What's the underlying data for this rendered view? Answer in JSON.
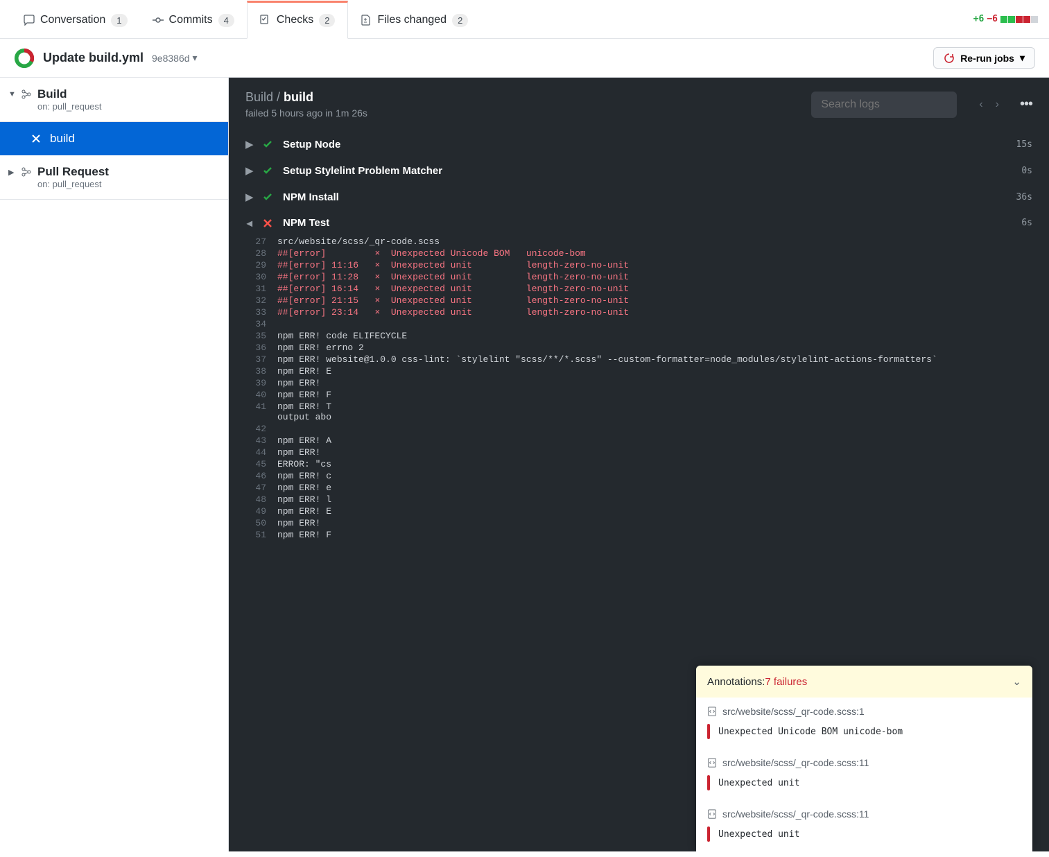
{
  "tabs": {
    "conversation": {
      "label": "Conversation",
      "count": "1"
    },
    "commits": {
      "label": "Commits",
      "count": "4"
    },
    "checks": {
      "label": "Checks",
      "count": "2"
    },
    "files": {
      "label": "Files changed",
      "count": "2"
    }
  },
  "diffstat": {
    "additions": "+6",
    "deletions": "−6"
  },
  "pr": {
    "title": "Update build.yml",
    "sha": "9e8386d",
    "rerun_label": "Re-run jobs"
  },
  "workflows": [
    {
      "name": "Build",
      "trigger": "on: pull_request",
      "jobs": [
        {
          "name": "build",
          "status": "fail",
          "active": true
        }
      ]
    },
    {
      "name": "Pull Request",
      "trigger": "on: pull_request",
      "jobs": []
    }
  ],
  "log": {
    "breadcrumb_parent": "Build",
    "breadcrumb_sep": " / ",
    "breadcrumb_current": "build",
    "status_line": "failed 5 hours ago in 1m 26s",
    "search_placeholder": "Search logs"
  },
  "steps": [
    {
      "name": "Setup Node",
      "status": "pass",
      "time": "15s",
      "expanded": false
    },
    {
      "name": "Setup Stylelint Problem Matcher",
      "status": "pass",
      "time": "0s",
      "expanded": false
    },
    {
      "name": "NPM Install",
      "status": "pass",
      "time": "36s",
      "expanded": false
    },
    {
      "name": "NPM Test",
      "status": "fail",
      "time": "6s",
      "expanded": true
    }
  ],
  "loglines": [
    {
      "n": "27",
      "text": "src/website/scss/_qr-code.scss"
    },
    {
      "n": "28",
      "err": true,
      "prefix": "##[error]",
      "loc": "",
      "x": "×",
      "msg": "Unexpected Unicode BOM",
      "rule": "unicode-bom"
    },
    {
      "n": "29",
      "err": true,
      "prefix": "##[error]",
      "loc": "11:16",
      "x": "×",
      "msg": "Unexpected unit",
      "rule": "length-zero-no-unit"
    },
    {
      "n": "30",
      "err": true,
      "prefix": "##[error]",
      "loc": "11:28",
      "x": "×",
      "msg": "Unexpected unit",
      "rule": "length-zero-no-unit"
    },
    {
      "n": "31",
      "err": true,
      "prefix": "##[error]",
      "loc": "16:14",
      "x": "×",
      "msg": "Unexpected unit",
      "rule": "length-zero-no-unit"
    },
    {
      "n": "32",
      "err": true,
      "prefix": "##[error]",
      "loc": "21:15",
      "x": "×",
      "msg": "Unexpected unit",
      "rule": "length-zero-no-unit"
    },
    {
      "n": "33",
      "err": true,
      "prefix": "##[error]",
      "loc": "23:14",
      "x": "×",
      "msg": "Unexpected unit",
      "rule": "length-zero-no-unit"
    },
    {
      "n": "34",
      "text": ""
    },
    {
      "n": "35",
      "text": "npm ERR! code ELIFECYCLE"
    },
    {
      "n": "36",
      "text": "npm ERR! errno 2"
    },
    {
      "n": "37",
      "text": "npm ERR! website@1.0.0 css-lint: `stylelint \"scss/**/*.scss\" --custom-formatter=node_modules/stylelint-actions-formatters`"
    },
    {
      "n": "38",
      "text": "npm ERR! E"
    },
    {
      "n": "39",
      "text": "npm ERR! "
    },
    {
      "n": "40",
      "text": "npm ERR! F"
    },
    {
      "n": "41",
      "text": "npm ERR! T\noutput abo"
    },
    {
      "n": "42",
      "text": ""
    },
    {
      "n": "43",
      "text": "npm ERR! A"
    },
    {
      "n": "44",
      "text": "npm ERR!"
    },
    {
      "n": "45",
      "text": "ERROR: \"cs"
    },
    {
      "n": "46",
      "text": "npm ERR! c"
    },
    {
      "n": "47",
      "text": "npm ERR! e"
    },
    {
      "n": "48",
      "text": "npm ERR! l"
    },
    {
      "n": "49",
      "text": "npm ERR! E"
    },
    {
      "n": "50",
      "text": "npm ERR!"
    },
    {
      "n": "51",
      "text": "npm ERR! F"
    }
  ],
  "annotations": {
    "header_label": "Annotations: ",
    "header_count": "7 failures",
    "items": [
      {
        "file": "src/website/scss/_qr-code.scss:1",
        "msg": "Unexpected Unicode BOM   unicode-bom"
      },
      {
        "file": "src/website/scss/_qr-code.scss:11",
        "msg": "Unexpected unit"
      },
      {
        "file": "src/website/scss/_qr-code.scss:11",
        "msg": "Unexpected unit"
      }
    ]
  }
}
